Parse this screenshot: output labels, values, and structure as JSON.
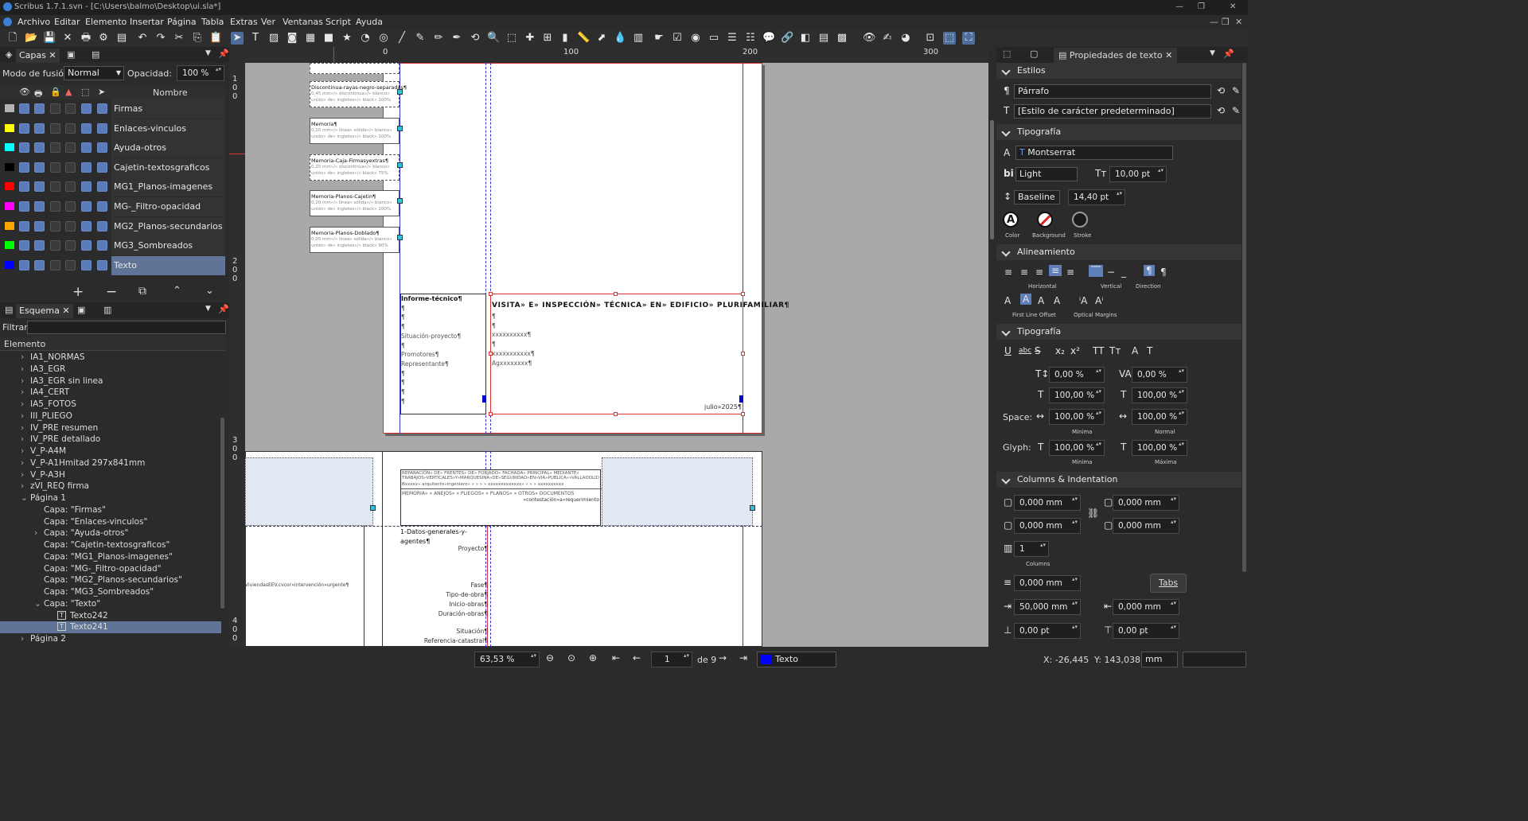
{
  "window": {
    "title": "Scribus 1.7.1.svn - [C:\\Users\\balmo\\Desktop\\ui.sla*]"
  },
  "menu": [
    "Archivo",
    "Editar",
    "Elemento",
    "Insertar",
    "Página",
    "Tabla",
    "Extras",
    "Ver",
    "Ventanas",
    "Script",
    "Ayuda"
  ],
  "layers_panel": {
    "tab_label": "Capas",
    "blend_label": "Modo de fusión:",
    "blend_value": "Normal",
    "opacity_label": "Opacidad:",
    "opacity_value": "100 %",
    "name_header": "Nombre",
    "layers": [
      {
        "name": "Firmas",
        "color": "#b4b4b4"
      },
      {
        "name": "Enlaces-vinculos",
        "color": "#ffff00"
      },
      {
        "name": "Ayuda-otros",
        "color": "#00ffff"
      },
      {
        "name": "Cajetin-textosgraficos",
        "color": "#000000"
      },
      {
        "name": "MG1_Planos-imagenes",
        "color": "#ff0000"
      },
      {
        "name": "MG-_Filtro-opacidad",
        "color": "#ff00ff"
      },
      {
        "name": "MG2_Planos-secundarios",
        "color": "#ffa500"
      },
      {
        "name": "MG3_Sombreados",
        "color": "#00ff00"
      },
      {
        "name": "Texto",
        "color": "#0000ff"
      }
    ]
  },
  "outline_panel": {
    "tab_label": "Esquema",
    "filter_label": "Filtrar:",
    "header": "Elemento",
    "items": [
      "IA1_NORMAS",
      "IA3_EGR",
      "IA3_EGR sin linea",
      "IA4_CERT",
      "IA5_FOTOS",
      "III_PLIEGO",
      "IV_PRE resumen",
      "IV_PRE detallado",
      "V_P-A4M",
      "V_P-A1Hmitad 297x841mm",
      "V_P-A3H",
      "zVI_REQ firma",
      "Página 1",
      "Capa: \"Firmas\"",
      "Capa: \"Enlaces-vinculos\"",
      "Capa: \"Ayuda-otros\"",
      "Capa: \"Cajetin-textosgraficos\"",
      "Capa: \"MG1_Planos-imagenes\"",
      "Capa: \"MG-_Filtro-opacidad\"",
      "Capa: \"MG2_Planos-secundarios\"",
      "Capa: \"MG3_Sombreados\"",
      "Capa: \"Texto\"",
      "Texto242",
      "Texto241",
      "Página 2"
    ]
  },
  "ruler": {
    "h": [
      "0",
      "100",
      "200",
      "300"
    ],
    "v": [
      "1\n0\n0",
      "2\n0\n0",
      "3\n0\n0",
      "4\n0\n0"
    ]
  },
  "document": {
    "styles": [
      {
        "title": "Discontinua-rayas-negro-separadas¶",
        "lines": [
          "0,45 mm»/» discontinua»/» blanco»",
          "unión» de» ingletes»/» black» 100%"
        ]
      },
      {
        "title": "Memoria¶",
        "lines": [
          "0,10 mm»/» línea» sólida»/» blanco»",
          "unión» de» ingletes»/» black» 100%"
        ]
      },
      {
        "title": "Memoria-Caja-Firmasyextras¶",
        "lines": [
          "0,25 mm»/» discontinua»/» blanco»",
          "unión» de» ingletes»/» black» 75%"
        ]
      },
      {
        "title": "Memoria-Planos-Cajetin¶",
        "lines": [
          "0,20 mm»/» línea» sólida»/» blanco»",
          "unión» de» ingletes»/» black» 100%"
        ]
      },
      {
        "title": "Memoria-Planos-Doblado¶",
        "lines": [
          "0,05 mm»/» línea» sólida»/» blanco»",
          "unión» de» ingletes»/» black» 90%"
        ]
      }
    ],
    "left_frame": [
      "Informe-técnico¶",
      "¶",
      "¶",
      "¶",
      "Situación-proyecto¶",
      "¶",
      "Promotores¶",
      "Representante¶",
      "¶",
      "¶",
      "¶",
      "¶"
    ],
    "right_frame_title": "VISITA» E» INSPECCIÓN» TÉCNICA» EN» EDIFICIO» PLURIFAMILIAR¶",
    "right_frame_lines": [
      "¶",
      "¶",
      "xxxxxxxxxx¶",
      "¶",
      "xxxxxxxxxxx¶",
      "Agxxxxxxxx¶"
    ],
    "date": "julio»2025¶",
    "page2_header1": "REPARACIÓN» DE» FRENTES» DE» FORJADO» FACHADA» PRINCIPAL» MEDIANTE» TRABAJOS»VERTICALES»Y»MARQUESINA»DE»SEGURIDAD»EN»VIA»PUBLICA»»VALLADOLID",
    "page2_header2": "Bxxxxx» arquitecto»ingeniero» » » » » xxxxxxxxxxxxx» » » » xxxxxxxxxx",
    "page2_header3": "MEMORIA» » ANEJOS» » PLIEGOS» » PLANOS» » OTROS» DOCUMENTOS",
    "page2_header4": "»contestación»a»requerimiento",
    "page2_section": "1-Datos-generales-y-agentes¶",
    "page2_fields": [
      "Proyecto¶",
      "Fase¶",
      "Tipo-de-obra¶",
      "Inicio-obras¶",
      "Duración-obras¶",
      "Situación¶",
      "Referencia-catastral¶"
    ],
    "page2_left_text": "ViviendasEEV.cvcor»intervención»urgente¶"
  },
  "properties": {
    "tab_label": "Propiedades de texto",
    "sections": {
      "styles": "Estilos",
      "typo": "Tipografía",
      "align": "Alineamiento",
      "typo2": "Tipografía",
      "columns": "Columns & Indentation"
    },
    "paragraph_style": "Párrafo",
    "char_style": "[Estilo de carácter predeterminado]",
    "font": "Montserrat",
    "weight": "Light",
    "size": "10,00 pt",
    "baseline": "Baseline",
    "line_spacing": "14,40 pt",
    "color_labels": [
      "Color",
      "Background",
      "Stroke"
    ],
    "align_labels": [
      "Horizontal",
      "Vertical",
      "Direction",
      "First Line Offset",
      "Optical Margins"
    ],
    "offsets": [
      "0,00 %",
      "0,00 %",
      "100,00 %",
      "100,00 %",
      "100,00 %",
      "100,00 %",
      "100,00 %",
      "100,00 %"
    ],
    "space_label": "Space:",
    "glyph_label": "Glyph:",
    "minima": "Mínima",
    "normal": "Normal",
    "maxima": "Máxima",
    "margins": [
      "0,000 mm",
      "0,000 mm",
      "0,000 mm",
      "0,000 mm"
    ],
    "columns": "1",
    "columns_label": "Columns",
    "gap": "0,000 mm",
    "tabs_button": "Tabs",
    "indent_left": "50,000 mm",
    "indent_right": "0,000 mm",
    "space_before": "0,00 pt",
    "space_after": "0,00 pt"
  },
  "status": {
    "zoom": "63,53 %",
    "page": "1",
    "of": "de 9",
    "layer": "Texto",
    "x": "X:  -26,445",
    "y": "Y:  143,038",
    "unit": "mm"
  }
}
